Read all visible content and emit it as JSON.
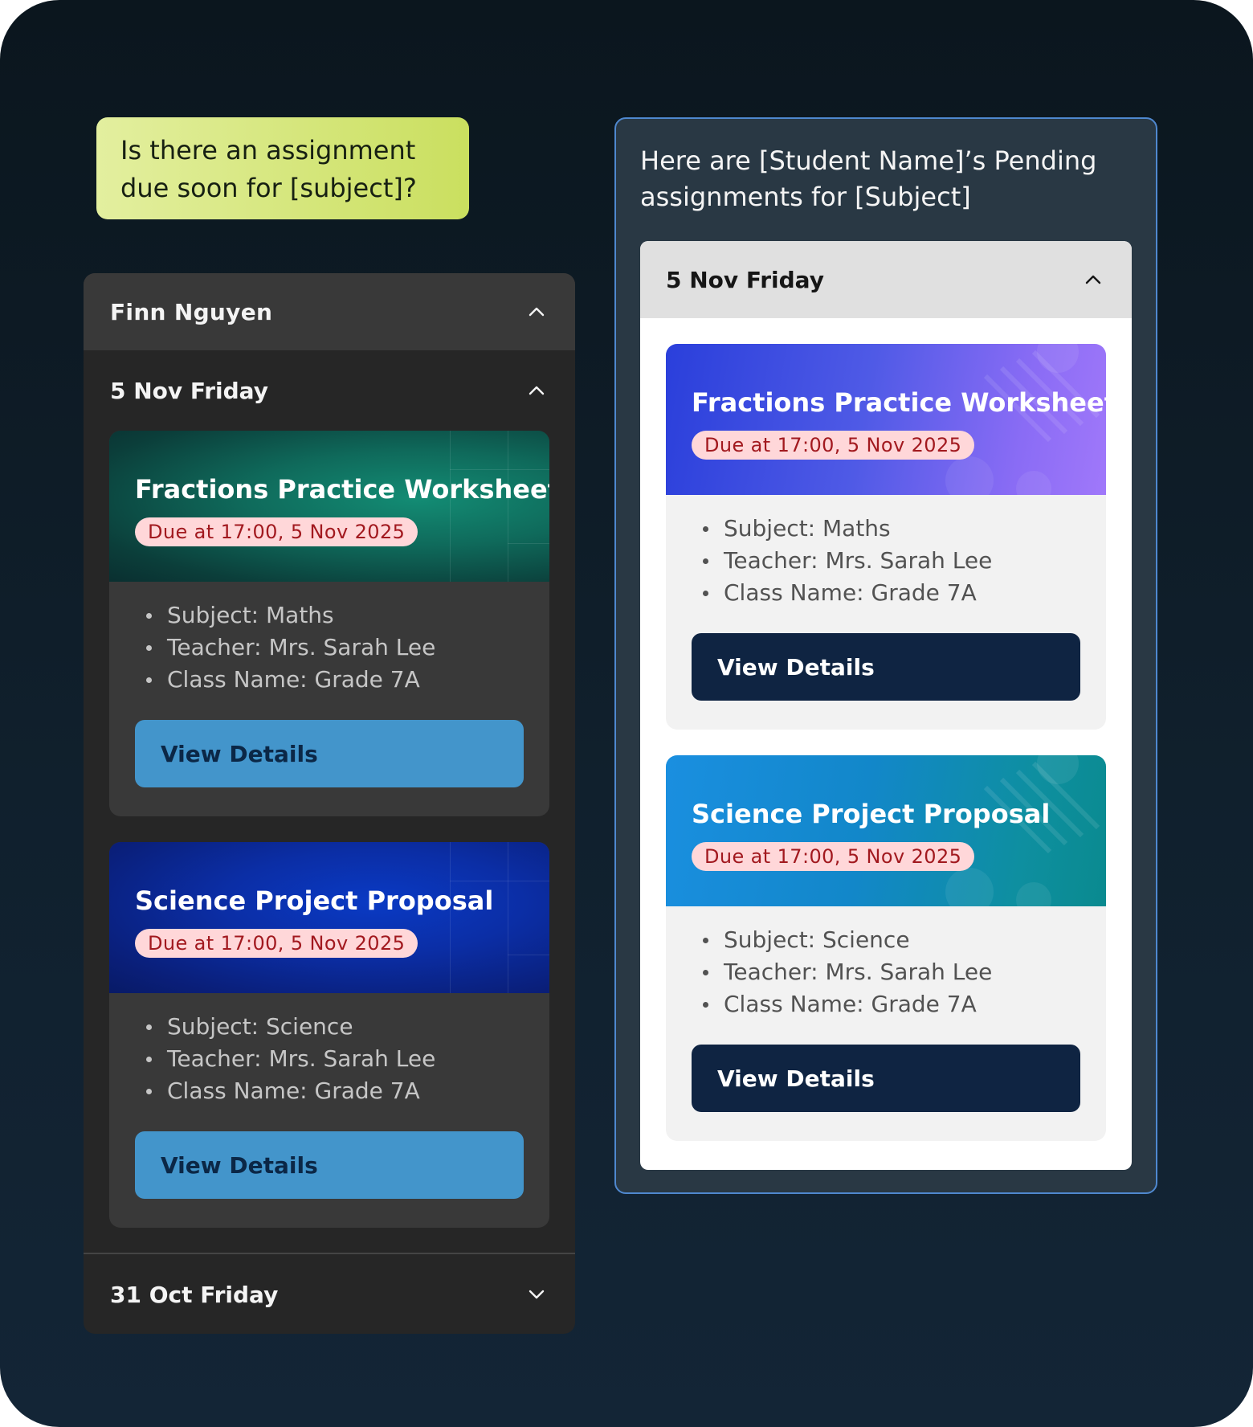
{
  "user_message": "Is there an assignment due soon for [subject]?",
  "dark_view": {
    "student_name": "Finn Nguyen",
    "groups": [
      {
        "date": "5 Nov  Friday",
        "expanded": true,
        "assignments": [
          {
            "title": "Fractions Practice Worksheet",
            "due": "Due at 17:00, 5 Nov 2025",
            "details": [
              "Subject: Maths",
              "Teacher: Mrs. Sarah Lee",
              "Class Name: Grade 7A"
            ],
            "button_label": "View Details",
            "banner_color": "#0f6a5b"
          },
          {
            "title": "Science Project Proposal",
            "due": "Due at 17:00, 5 Nov 2025",
            "details": [
              "Subject: Science",
              "Teacher: Mrs. Sarah Lee",
              "Class Name: Grade 7A"
            ],
            "button_label": "View Details",
            "banner_color": "#0b2ea6"
          }
        ]
      },
      {
        "date": "31 Oct  Friday",
        "expanded": false
      }
    ]
  },
  "light_view": {
    "intro": "Here are [Student Name]’s Pending assignments for [Subject]",
    "date": "5 Nov  Friday",
    "expanded": true,
    "assignments": [
      {
        "title": "Fractions Practice Worksheet",
        "due": "Due at 17:00, 5 Nov 2025",
        "details": [
          "Subject: Maths",
          "Teacher: Mrs. Sarah Lee",
          "Class Name: Grade 7A"
        ],
        "button_label": "View Details",
        "banner_color": "#4f5ae6"
      },
      {
        "title": "Science Project Proposal",
        "due": "Due at 17:00, 5 Nov 2025",
        "details": [
          "Subject: Science",
          "Teacher: Mrs. Sarah Lee",
          "Class Name: Grade 7A"
        ],
        "button_label": "View Details",
        "banner_color": "#1287c9"
      }
    ]
  },
  "colors": {
    "bubble": "#cadf5f",
    "dark_button": "#4395cb",
    "light_button": "#0f2442",
    "due_pill_bg": "#ffd7d9",
    "due_pill_text": "#a2191f",
    "light_panel_border": "#4f88cf"
  },
  "icons": {
    "expanded": "chevron-up-icon",
    "collapsed": "chevron-down-icon"
  }
}
